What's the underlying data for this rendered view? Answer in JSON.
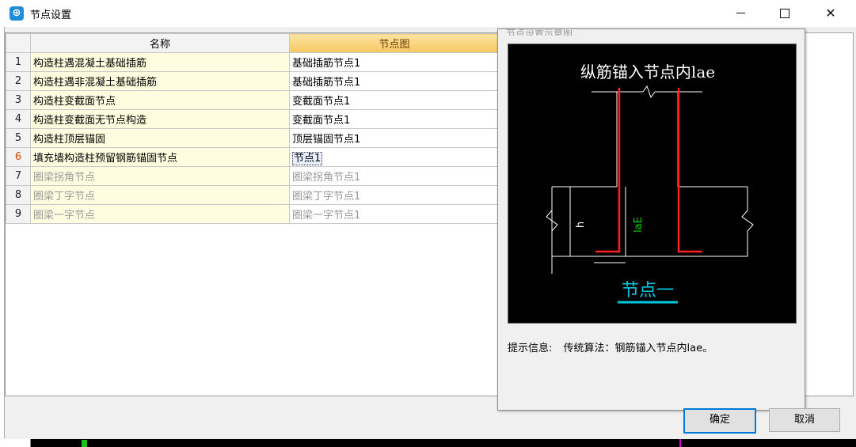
{
  "window": {
    "title": "节点设置",
    "minimize": "—",
    "maximize": "☐",
    "close": "✕"
  },
  "grid": {
    "headers": {
      "name": "名称",
      "node": "节点图"
    },
    "rows": [
      {
        "num": "1",
        "name": "构造柱遇混凝土基础插筋",
        "node": "基础插筋节点1"
      },
      {
        "num": "2",
        "name": "构造柱遇非混凝土基础插筋",
        "node": "基础插筋节点1"
      },
      {
        "num": "3",
        "name": "构造柱变截面节点",
        "node": "变截面节点1"
      },
      {
        "num": "4",
        "name": "构造柱变截面无节点构造",
        "node": "变截面节点1"
      },
      {
        "num": "5",
        "name": "构造柱顶层锚固",
        "node": "顶层锚固节点1"
      },
      {
        "num": "6",
        "name": "填充墙构造柱预留钢筋锚固节点",
        "node": "节点1"
      },
      {
        "num": "7",
        "name": "圈梁拐角节点",
        "node": "圈梁拐角节点1"
      },
      {
        "num": "8",
        "name": "圈梁丁字节点",
        "node": "圈梁丁字节点1"
      },
      {
        "num": "9",
        "name": "圈梁一字节点",
        "node": "圈梁一字节点1"
      }
    ]
  },
  "popup": {
    "caption": "节点设置示意图",
    "diagram": {
      "title": "纵筋锚入节点内lae",
      "dim_h": "h",
      "dim_lae": "laE",
      "caption": "节点一"
    },
    "hint_label": "提示信息:",
    "hint_text": "传统算法：钢筋锚入节点内lae。"
  },
  "buttons": {
    "ok": "确定",
    "cancel": "取消"
  },
  "colors": {
    "accent": "#0078d7",
    "rebar": "#ff2020",
    "dim_green": "#00dd00",
    "caption_cyan": "#00c8e0"
  }
}
